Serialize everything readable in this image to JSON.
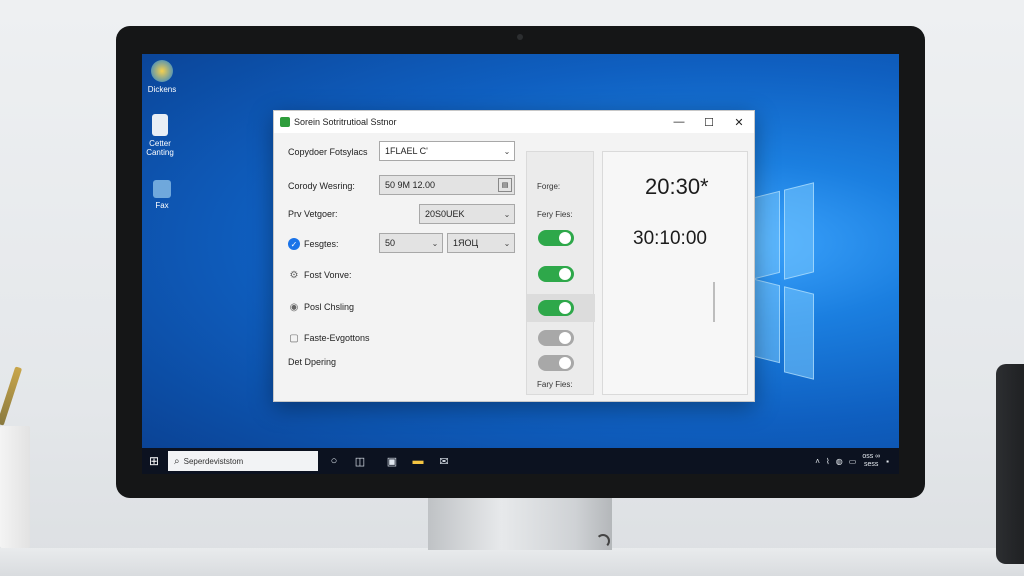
{
  "desktop": {
    "icons": [
      {
        "label": "Dickens",
        "color": "#f0b322"
      },
      {
        "label": "Cetter Canting",
        "color": "#e8eef5"
      },
      {
        "label": "Fax",
        "color": "#6fa8dc"
      }
    ]
  },
  "taskbar": {
    "start_icon": "windows-start-icon",
    "search_placeholder": "Seperdeviststom",
    "clock_line1": "oss ∞",
    "clock_line2": "sess"
  },
  "dialog": {
    "title": "Sorein Sotritrutioal Sstnor",
    "controls": {
      "minimize": "—",
      "maximize": "☐",
      "close": "✕"
    },
    "rows": [
      {
        "label": "Copydoer Fotsylacs",
        "value": "1FLAEL C'"
      },
      {
        "label": "Corody Wesring:",
        "value": "50 9M 12.00"
      },
      {
        "label": "Prv Vetgoer:",
        "value": "20S0UEK"
      },
      {
        "label": "Fesgtes:",
        "value_a": "50",
        "value_b": "1ЯOЦ"
      },
      {
        "label": "Fost Vonve:"
      },
      {
        "label": "Posl Chsling"
      },
      {
        "label": "Faste-Evgottons"
      },
      {
        "label": "Det Dpering"
      }
    ],
    "mid": {
      "label_top": "Forge:",
      "label_toggles": "Fery Fies:",
      "label_bottom": "Fary Fies:",
      "toggles": [
        true,
        true,
        true,
        false,
        false
      ]
    },
    "clock": {
      "time_a": "20:30*",
      "time_b": "30:10:00"
    }
  },
  "colors": {
    "toggle_on": "#2ea84a",
    "toggle_off": "#a8a8a8",
    "accent": "#1a73e8"
  }
}
